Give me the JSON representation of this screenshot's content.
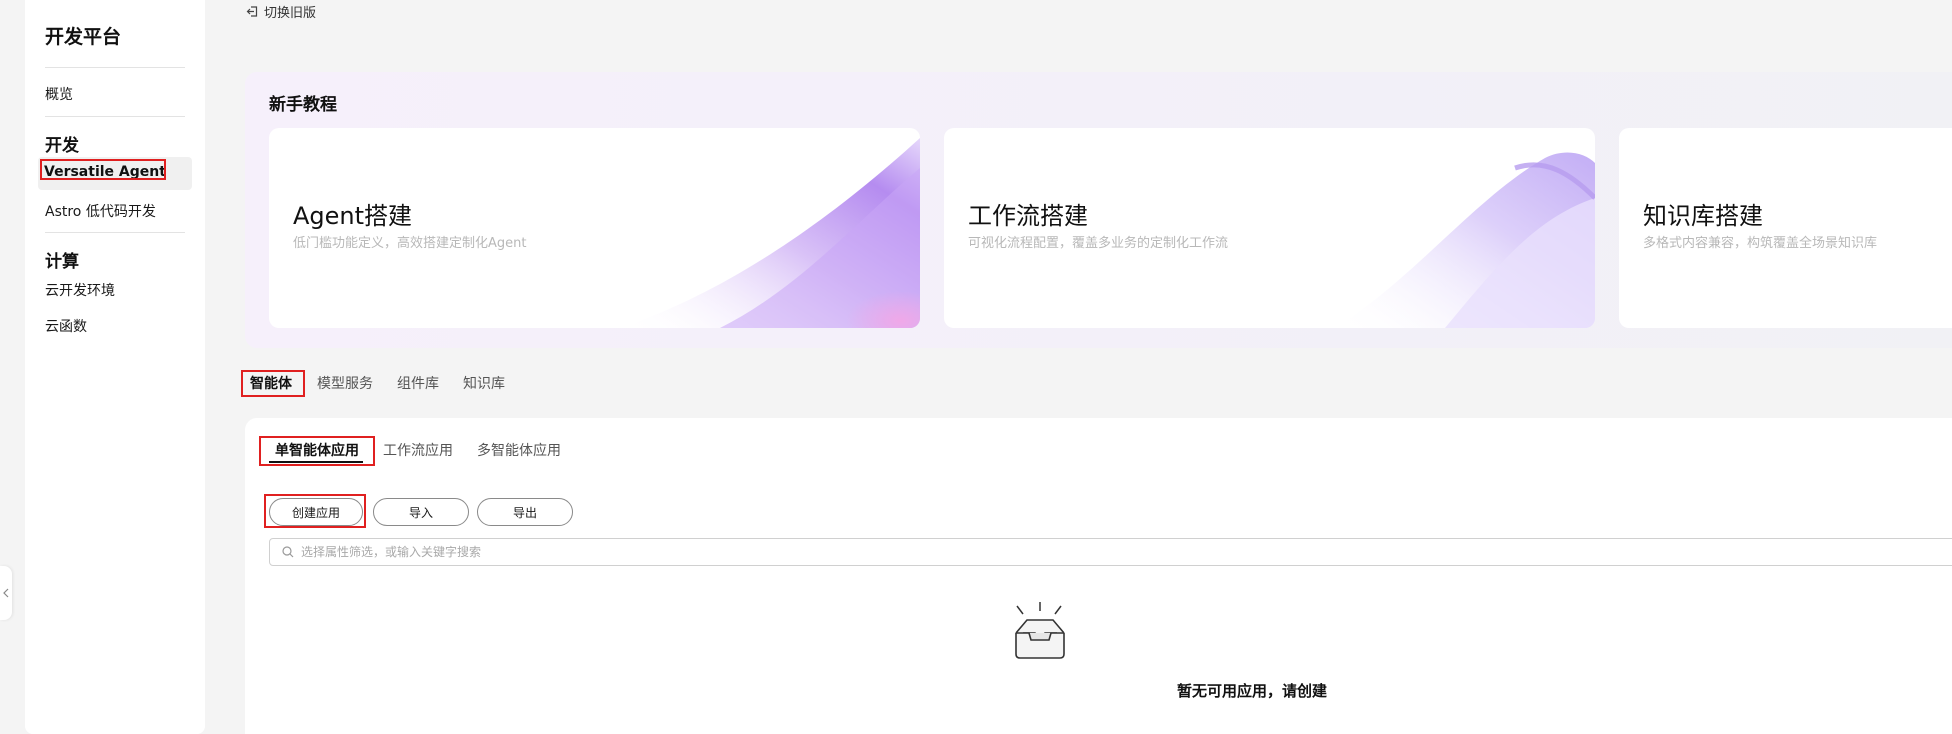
{
  "sidebar": {
    "title": "开发平台",
    "overview": "概览",
    "groups": [
      {
        "label": "开发",
        "items": [
          "Versatile Agent",
          "Astro 低代码开发"
        ]
      },
      {
        "label": "计算",
        "items": [
          "云开发环境",
          "云函数"
        ]
      }
    ],
    "active_item": "Versatile Agent"
  },
  "header": {
    "switch_old": "切换旧版"
  },
  "tutorial": {
    "title": "新手教程",
    "cards": [
      {
        "name": "Agent搭建",
        "desc": "低门槛功能定义，高效搭建定制化Agent"
      },
      {
        "name": "工作流搭建",
        "desc": "可视化流程配置，覆盖多业务的定制化工作流"
      },
      {
        "name": "知识库搭建",
        "desc": "多格式内容兼容，构筑覆盖全场景知识库"
      }
    ]
  },
  "main_tabs": [
    {
      "label": "智能体",
      "active": true
    },
    {
      "label": "模型服务",
      "active": false
    },
    {
      "label": "组件库",
      "active": false
    },
    {
      "label": "知识库",
      "active": false
    }
  ],
  "sub_tabs": [
    {
      "label": "单智能体应用",
      "active": true
    },
    {
      "label": "工作流应用",
      "active": false
    },
    {
      "label": "多智能体应用",
      "active": false
    }
  ],
  "actions": {
    "create": "创建应用",
    "import": "导入",
    "export": "导出"
  },
  "search": {
    "placeholder": "选择属性筛选，或输入关键字搜索",
    "value": ""
  },
  "empty_state": {
    "message": "暂无可用应用，请创建",
    "icon": "empty-inbox-icon"
  },
  "colors": {
    "highlight": "#e02020",
    "accent_purple": "#a77be8"
  }
}
